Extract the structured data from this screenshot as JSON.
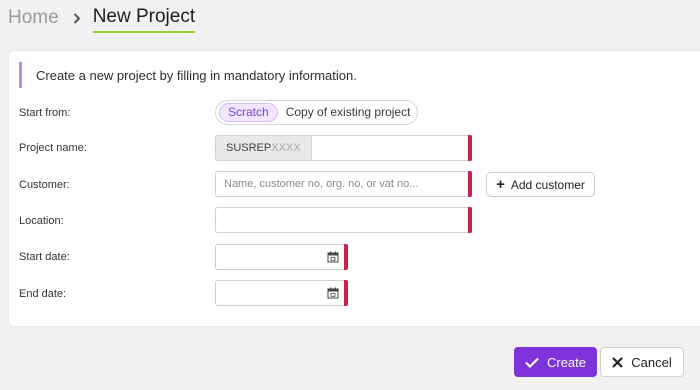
{
  "breadcrumb": {
    "home": "Home",
    "current": "New Project"
  },
  "form": {
    "info": "Create a new project by filling in mandatory information.",
    "start_from": {
      "label": "Start from:",
      "options": [
        "Scratch",
        "Copy of existing project"
      ],
      "selected": "Scratch"
    },
    "project_name": {
      "label": "Project name:",
      "prefix_fixed": "SUSREP",
      "prefix_mask": "XXXX",
      "value": ""
    },
    "customer": {
      "label": "Customer:",
      "placeholder": "Name, customer no, org. no, or vat no...",
      "value": "",
      "add_label": "Add customer"
    },
    "location": {
      "label": "Location:",
      "value": ""
    },
    "start_date": {
      "label": "Start date:",
      "value": ""
    },
    "end_date": {
      "label": "End date:",
      "value": ""
    }
  },
  "actions": {
    "create": "Create",
    "cancel": "Cancel"
  },
  "colors": {
    "accent": "#7d33d9",
    "required": "#c4234a",
    "breadcrumb_underline": "#9acd32",
    "info_bar": "#b48cf0"
  },
  "icons": {
    "separator": "chevron-right-icon",
    "add": "plus-icon",
    "calendar": "calendar-icon",
    "create": "check-icon",
    "cancel": "close-icon"
  }
}
